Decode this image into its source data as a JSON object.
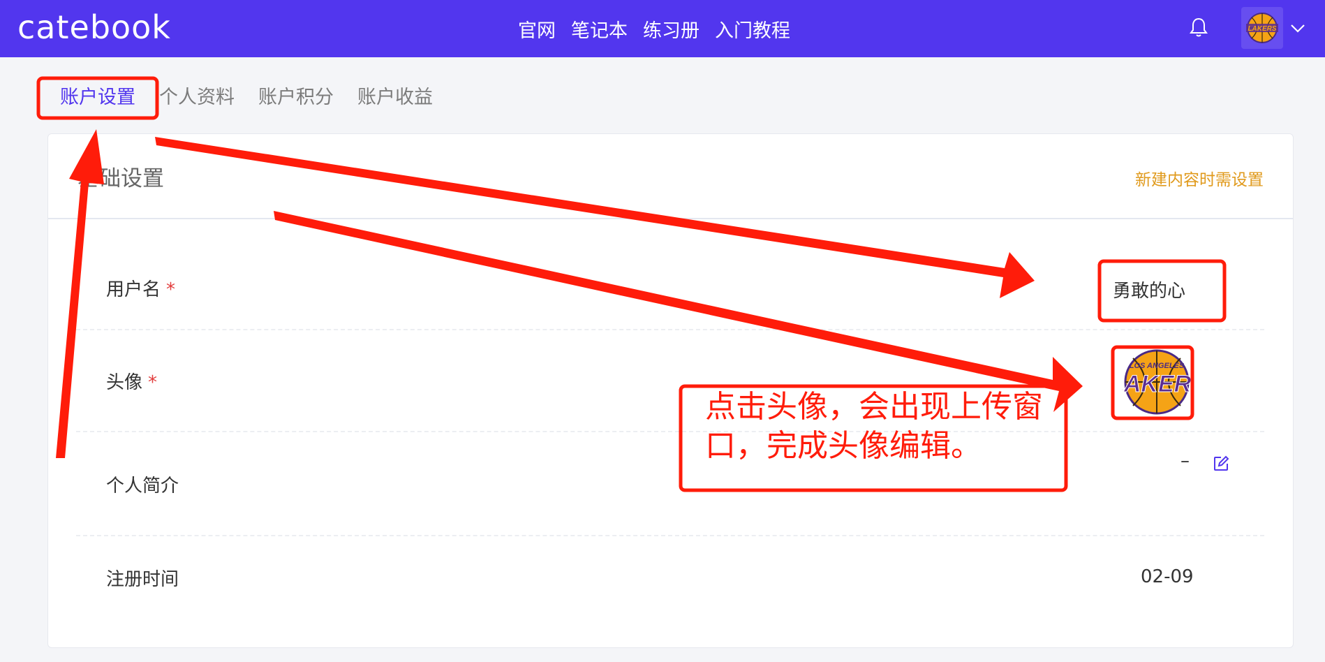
{
  "header": {
    "logo": "catebook",
    "nav": [
      "官网",
      "笔记本",
      "练习册",
      "入门教程"
    ],
    "avatar_icon": "lakers-logo-icon",
    "bell_icon": "bell-icon",
    "dropdown_icon": "chevron-down-icon"
  },
  "tabs": [
    {
      "label": "账户设置",
      "active": true
    },
    {
      "label": "个人资料",
      "active": false
    },
    {
      "label": "账户积分",
      "active": false
    },
    {
      "label": "账户收益",
      "active": false
    }
  ],
  "card": {
    "title": "基础设置",
    "header_link": "新建内容时需设置"
  },
  "rows": {
    "username": {
      "label": "用户名",
      "required": "*",
      "value": "勇敢的心"
    },
    "avatar": {
      "label": "头像",
      "required": "*",
      "logo_text": "LOS ANGELES",
      "logo_word": "LAKERS"
    },
    "bio": {
      "label": "个人简介",
      "value": "–",
      "edit_icon": "edit-icon"
    },
    "registered": {
      "label": "注册时间",
      "value": "02-09"
    }
  },
  "annotation": {
    "text": "点击头像，会出现上传窗口，完成头像编辑。"
  },
  "colors": {
    "brand": "#5236ee",
    "accent_link": "#e09a1c",
    "annotation_red": "#ff1c0a",
    "required_red": "#e23c3c"
  }
}
